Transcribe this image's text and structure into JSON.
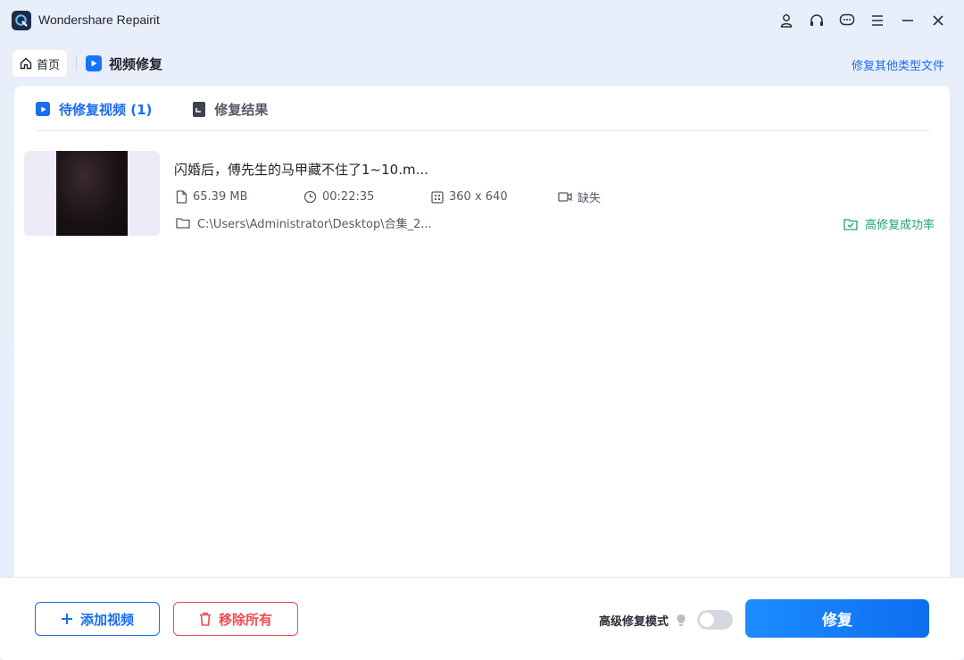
{
  "app": {
    "title": "Wondershare Repairit"
  },
  "breadcrumb": {
    "home_label": "首页",
    "current_label": "视频修复",
    "other_link": "修复其他类型文件"
  },
  "tabs": [
    {
      "label": "待修复视频 (1)",
      "active": true
    },
    {
      "label": "修复结果",
      "active": false
    }
  ],
  "file": {
    "name": "闪婚后，傅先生的马甲藏不住了1~10.m...",
    "size": "65.39 MB",
    "duration": "00:22:35",
    "resolution": "360 x 640",
    "audio": "缺失",
    "path": "C:\\Users\\Administrator\\Desktop\\合集_2...",
    "badge": "高修复成功率"
  },
  "footer": {
    "add_label": "添加视频",
    "remove_label": "移除所有",
    "advanced_label": "高级修复模式",
    "advanced_enabled": false,
    "repair_label": "修复"
  },
  "colors": {
    "accent": "#1a6cf0",
    "danger": "#f04b52",
    "success": "#1fa36a"
  }
}
